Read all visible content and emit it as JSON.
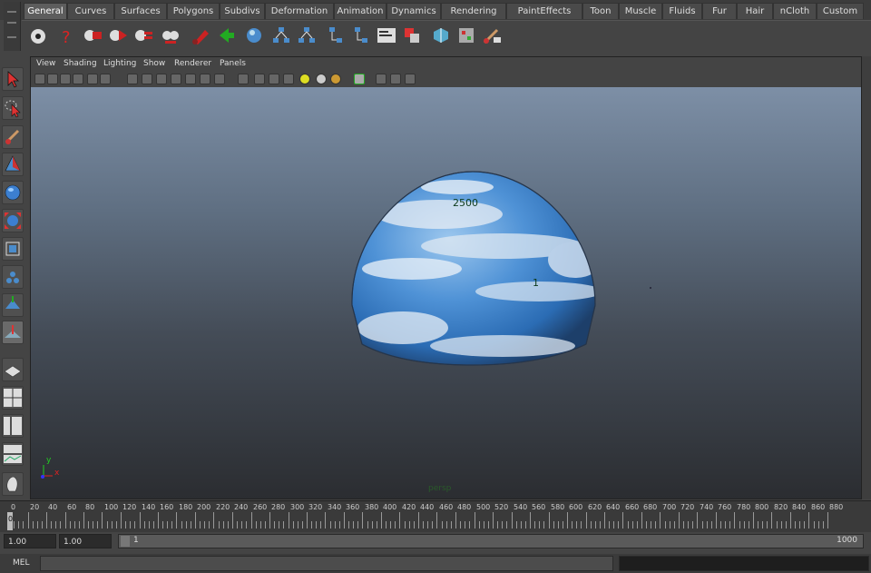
{
  "shelf": {
    "tabs": [
      "General",
      "Curves",
      "Surfaces",
      "Polygons",
      "Subdivs",
      "Deformation",
      "Animation",
      "Dynamics",
      "Rendering",
      "PaintEffects",
      "Toon",
      "Muscle",
      "Fluids",
      "Fur",
      "Hair",
      "nCloth",
      "Custom"
    ],
    "active_tab": "General",
    "icons": [
      "render-view-icon",
      "help-icon",
      "render-icon",
      "ipr-render-icon",
      "hypershade-icon",
      "render-globals-icon",
      "paint-brush-icon",
      "green-arrow-icon",
      "sphere-light-icon",
      "hierarchy-icon",
      "hierarchy-2-icon",
      "hierarchy-3-icon",
      "hierarchy-4-icon",
      "outliner-icon",
      "graph-editor-icon",
      "texture-cube-icon",
      "dope-sheet-icon",
      "script-editor-icon"
    ]
  },
  "panel": {
    "menus": [
      "View",
      "Shading",
      "Lighting",
      "Show",
      "Renderer",
      "Panels"
    ],
    "camera_label": "persp",
    "axis": {
      "x": "x",
      "y": "y"
    }
  },
  "viewport": {
    "labels": [
      "2500",
      "1"
    ]
  },
  "timeline": {
    "ticks": [
      "0",
      "20",
      "40",
      "60",
      "80",
      "100",
      "120",
      "140",
      "160",
      "180",
      "200",
      "220",
      "240",
      "260",
      "280",
      "300",
      "320",
      "340",
      "360",
      "380",
      "400",
      "420",
      "440",
      "460",
      "480",
      "500",
      "520",
      "540",
      "560",
      "580",
      "600",
      "620",
      "640",
      "660",
      "680",
      "700",
      "720",
      "740",
      "760",
      "780",
      "800",
      "820",
      "840",
      "860",
      "880"
    ],
    "current_frame": "0"
  },
  "range": {
    "start_time": "1.00",
    "start_playback": "1.00",
    "range_start": "1",
    "range_end": "1000"
  },
  "command": {
    "label": "MEL",
    "value": ""
  }
}
